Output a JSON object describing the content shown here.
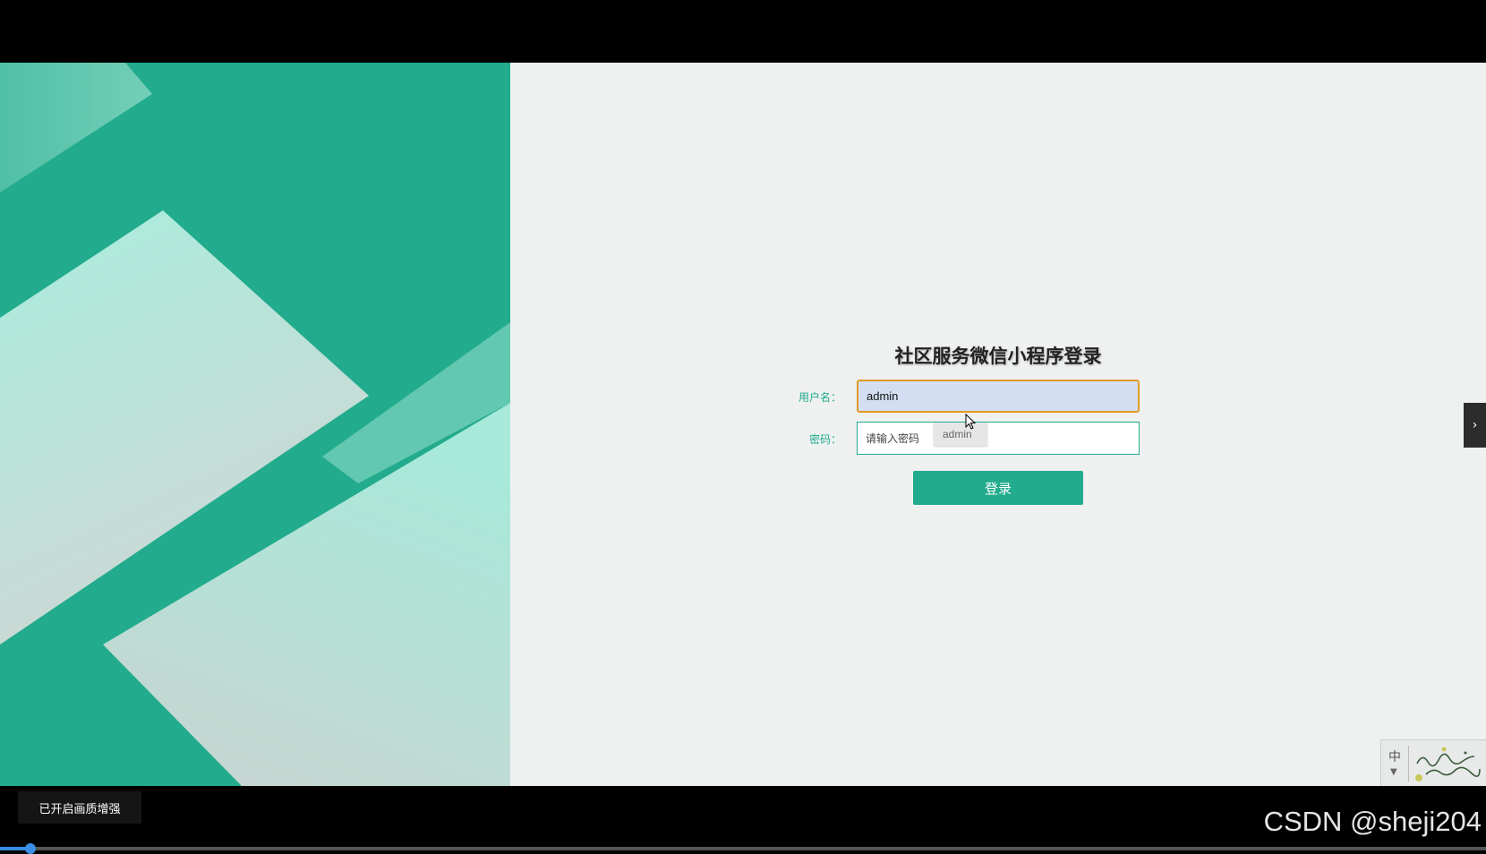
{
  "login": {
    "title": "社区服务微信小程序登录",
    "username_label": "用户名：",
    "username_value": "admin",
    "password_label": "密码：",
    "password_placeholder": "请输入密码",
    "autocomplete_suggestion": "admin",
    "login_button": "登录"
  },
  "ime": {
    "mode": "中"
  },
  "overlay": {
    "toast": "已开启画质增强",
    "watermark": "CSDN @sheji204"
  },
  "colors": {
    "brand_green": "#22ab8c",
    "focus_border": "#e19a25"
  },
  "video_progress": 0.02
}
